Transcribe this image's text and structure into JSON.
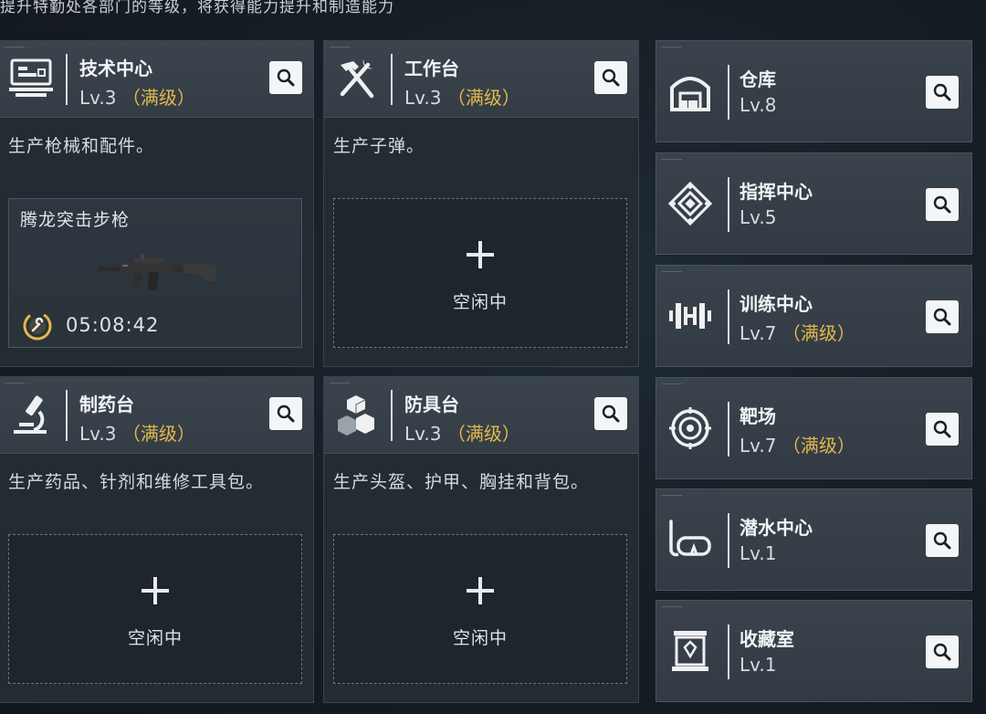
{
  "subtitle": "提升特勤处各部门的等级，将获得能力提升和制造能力",
  "accent_color": "#e2b84a",
  "workshops": [
    {
      "name": "技术中心",
      "level": "Lv.3",
      "maxed": "（满级）",
      "icon": "computer-terminal-icon",
      "description": "生产枪械和配件。",
      "slot": {
        "status": "busy",
        "item": "腾龙突击步枪",
        "timer": "05:08:42"
      }
    },
    {
      "name": "工作台",
      "level": "Lv.3",
      "maxed": "（满级）",
      "icon": "hammer-wrench-icon",
      "description": "生产子弹。",
      "slot": {
        "status": "idle",
        "label": "空闲中"
      }
    },
    {
      "name": "制药台",
      "level": "Lv.3",
      "maxed": "（满级）",
      "icon": "microscope-icon",
      "description": "生产药品、针剂和维修工具包。",
      "slot": {
        "status": "idle",
        "label": "空闲中"
      }
    },
    {
      "name": "防具台",
      "level": "Lv.3",
      "maxed": "（满级）",
      "icon": "armor-cubes-icon",
      "description": "生产头盔、护甲、胸挂和背包。",
      "slot": {
        "status": "idle",
        "label": "空闲中"
      }
    }
  ],
  "facilities": [
    {
      "name": "仓库",
      "level": "Lv.8",
      "maxed": "",
      "icon": "warehouse-icon"
    },
    {
      "name": "指挥中心",
      "level": "Lv.5",
      "maxed": "",
      "icon": "command-emblem-icon"
    },
    {
      "name": "训练中心",
      "level": "Lv.7",
      "maxed": "（满级）",
      "icon": "dumbbell-icon"
    },
    {
      "name": "靶场",
      "level": "Lv.7",
      "maxed": "（满级）",
      "icon": "target-icon"
    },
    {
      "name": "潜水中心",
      "level": "Lv.1",
      "maxed": "",
      "icon": "diving-mask-icon"
    },
    {
      "name": "收藏室",
      "level": "Lv.1",
      "maxed": "",
      "icon": "display-case-icon"
    }
  ]
}
